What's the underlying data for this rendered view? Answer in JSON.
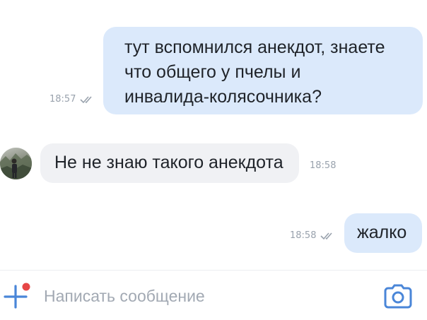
{
  "messages": [
    {
      "direction": "outgoing",
      "text": "тут вспомнился анекдот, знаете\nчто общего у пчелы и\nинвалида-колясочника?",
      "time": "18:57",
      "status": "read"
    },
    {
      "direction": "incoming",
      "text": "Не не знаю такого анекдота",
      "time": "18:58"
    },
    {
      "direction": "outgoing",
      "text": "жалко",
      "time": "18:58",
      "status": "read"
    }
  ],
  "composer": {
    "placeholder": "Написать сообщение",
    "value": ""
  },
  "icons": {
    "attach": "plus-icon",
    "notification_dot": "red-dot-icon",
    "camera": "camera-icon",
    "read_status": "double-check-icon"
  },
  "colors": {
    "outgoing_bubble": "#dbe9fb",
    "incoming_bubble": "#f0f1f4",
    "accent": "#4a86d8",
    "badge": "#e64646",
    "meta_text": "#99a2ad"
  }
}
